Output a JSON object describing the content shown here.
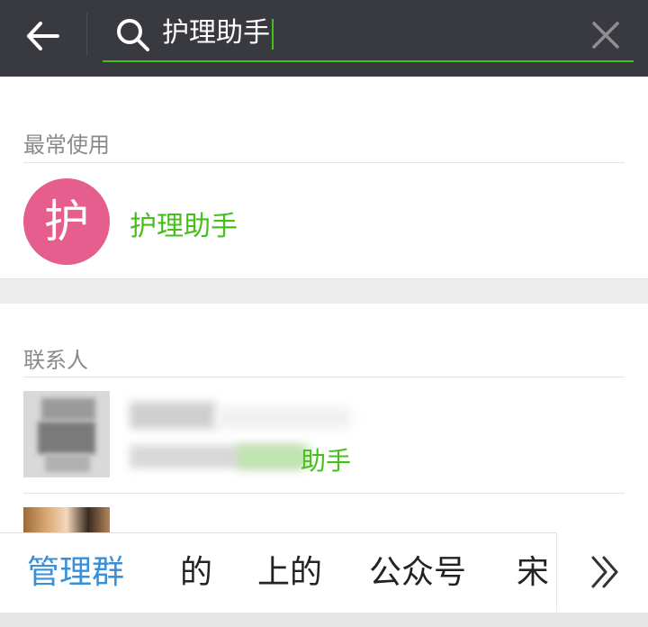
{
  "header": {
    "search_value": "护理助手",
    "colors": {
      "bar": "#393a3f",
      "accent": "#45c01a"
    },
    "icons": {
      "back": "arrow-left-icon",
      "search": "search-icon",
      "clear": "close-icon"
    }
  },
  "sections": {
    "most_used": {
      "title": "最常使用",
      "items": [
        {
          "avatar_char": "护",
          "name": "护理助手"
        }
      ]
    },
    "contacts": {
      "title": "联系人",
      "items": [
        {
          "match_text": "助手"
        }
      ]
    }
  },
  "suggestions": {
    "chips": [
      {
        "label": "管理群",
        "active": true
      },
      {
        "label": "的",
        "active": false
      },
      {
        "label": "上的",
        "active": false
      },
      {
        "label": "公众号",
        "active": false
      },
      {
        "label": "宋",
        "active": false
      }
    ],
    "more_icon": "double-chevron-right-icon"
  }
}
